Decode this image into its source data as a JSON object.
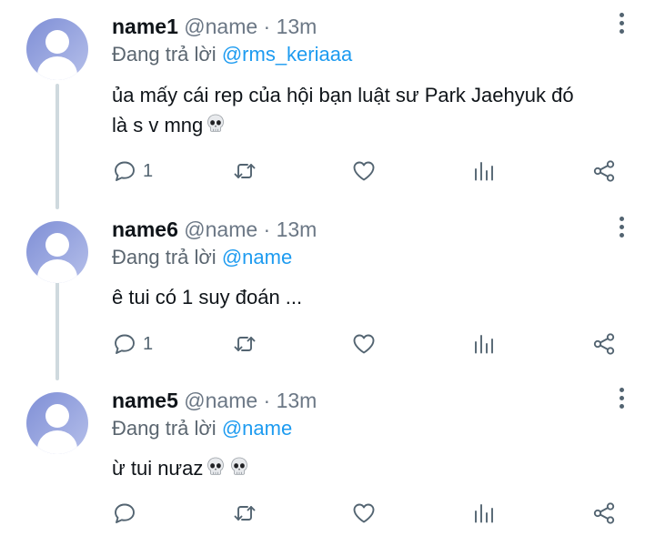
{
  "replying_prefix": "Đang trả lời",
  "tweets": [
    {
      "name": "name1",
      "handle": "@name · 13m",
      "reply_to": "@rms_keriaaa",
      "text_line1": "ủa mấy cái rep của hội bạn luật sư Park Jaehyuk đó",
      "text_line2": "là s v mng",
      "emoji": [
        "skull"
      ],
      "reply_count": "1"
    },
    {
      "name": "name6",
      "handle": "@name · 13m",
      "reply_to": "@name",
      "text_line1": "ê tui có 1 suy đoán ...",
      "text_line2": "",
      "emoji": [],
      "reply_count": "1"
    },
    {
      "name": "name5",
      "handle": "@name · 13m",
      "reply_to": "@name",
      "text_line1": "ừ tui nưaz",
      "text_line2": "",
      "emoji": [
        "skull",
        "skull"
      ],
      "reply_count": ""
    }
  ],
  "colors": {
    "link": "#1d9bf0",
    "avatar": "#8a98da",
    "muted": "#536471"
  }
}
